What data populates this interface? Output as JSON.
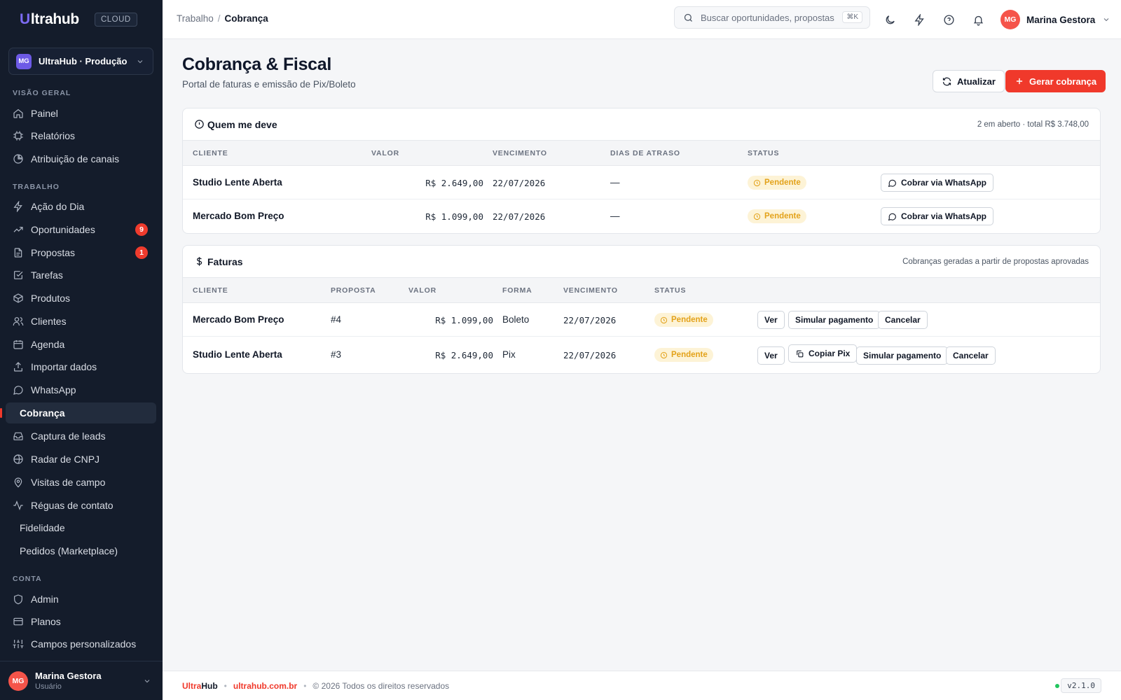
{
  "app": {
    "logo_text": "ltrahub",
    "logo_mark": "U",
    "cloud_badge": "CLOUD",
    "workspace": {
      "initials": "MG",
      "name": "UltraHub · Produção"
    }
  },
  "sidebar": {
    "sections": {
      "overview": "VISÃO GERAL",
      "work": "TRABALHO",
      "account": "CONTA"
    },
    "overview_items": [
      {
        "label": "Painel",
        "icon": "home-icon"
      },
      {
        "label": "Relatórios",
        "icon": "chip-icon"
      },
      {
        "label": "Atribuição de canais",
        "icon": "pie-chart-icon"
      }
    ],
    "work_items": [
      {
        "label": "Ação do Dia",
        "icon": "bolt-icon"
      },
      {
        "label": "Oportunidades",
        "icon": "trending-up-icon",
        "badge": "9"
      },
      {
        "label": "Propostas",
        "icon": "file-icon",
        "badge": "1"
      },
      {
        "label": "Tarefas",
        "icon": "check-square-icon"
      },
      {
        "label": "Produtos",
        "icon": "box-icon"
      },
      {
        "label": "Clientes",
        "icon": "users-icon"
      },
      {
        "label": "Agenda",
        "icon": "calendar-icon"
      },
      {
        "label": "Importar dados",
        "icon": "upload-icon"
      },
      {
        "label": "WhatsApp",
        "icon": "chat-icon"
      },
      {
        "label": "Cobrança",
        "icon": "none",
        "active": true
      },
      {
        "label": "Captura de leads",
        "icon": "inbox-icon"
      },
      {
        "label": "Radar de CNPJ",
        "icon": "radar-icon"
      },
      {
        "label": "Visitas de campo",
        "icon": "map-pin-icon"
      },
      {
        "label": "Réguas de contato",
        "icon": "activity-icon"
      },
      {
        "label": "Fidelidade",
        "icon": "none"
      },
      {
        "label": "Pedidos (Marketplace)",
        "icon": "none"
      }
    ],
    "account_items": [
      {
        "label": "Admin",
        "icon": "shield-icon"
      },
      {
        "label": "Planos",
        "icon": "credit-card-icon"
      },
      {
        "label": "Campos personalizados",
        "icon": "sliders-icon"
      }
    ],
    "user": {
      "initials": "MG",
      "name": "Marina Gestora",
      "role": "Usuário"
    }
  },
  "topbar": {
    "breadcrumb_parent": "Trabalho",
    "breadcrumb_sep": "/",
    "breadcrumb_current": "Cobrança",
    "search_placeholder": "Buscar oportunidades, propostas...",
    "search_shortcut": "⌘K",
    "user": {
      "initials": "MG",
      "name": "Marina Gestora"
    }
  },
  "page": {
    "title": "Cobrança & Fiscal",
    "subtitle": "Portal de faturas e emissão de Pix/Boleto",
    "refresh_label": "Atualizar",
    "create_label": "Gerar cobrança"
  },
  "debtors": {
    "title": "Quem me deve",
    "meta": "2 em aberto · total R$ 3.748,00",
    "columns": [
      "CLIENTE",
      "VALOR",
      "VENCIMENTO",
      "DIAS DE ATRASO",
      "STATUS"
    ],
    "rows": [
      {
        "client": "Studio Lente Aberta",
        "value": "R$ 2.649,00",
        "due": "22/07/2026",
        "late": "—",
        "status": "Pendente",
        "action": "Cobrar via WhatsApp"
      },
      {
        "client": "Mercado Bom Preço",
        "value": "R$ 1.099,00",
        "due": "22/07/2026",
        "late": "—",
        "status": "Pendente",
        "action": "Cobrar via WhatsApp"
      }
    ]
  },
  "invoices": {
    "title": "Faturas",
    "meta": "Cobranças geradas a partir de propostas aprovadas",
    "columns": [
      "CLIENTE",
      "PROPOSTA",
      "VALOR",
      "FORMA",
      "VENCIMENTO",
      "STATUS"
    ],
    "rows": [
      {
        "client": "Mercado Bom Preço",
        "proposal": "#4",
        "value": "R$ 1.099,00",
        "method": "Boleto",
        "due": "22/07/2026",
        "status": "Pendente",
        "view": "Ver",
        "copy_pix": "",
        "simulate": "Simular pagamento",
        "cancel": "Cancelar"
      },
      {
        "client": "Studio Lente Aberta",
        "proposal": "#3",
        "value": "R$ 2.649,00",
        "method": "Pix",
        "due": "22/07/2026",
        "status": "Pendente",
        "view": "Ver",
        "copy_pix": "Copiar Pix",
        "simulate": "Simular pagamento",
        "cancel": "Cancelar"
      }
    ]
  },
  "footer": {
    "brand_red": "Ultra",
    "brand_dark": "Hub",
    "site": "ultrahub.com.br",
    "copyright": "© 2026 Todos os direitos reservados",
    "version": "v2.1.0",
    "sep": "•"
  },
  "colors": {
    "accent": "#f0392b",
    "sidebar_bg": "#141c2b",
    "pending_bg": "#fdf3d6",
    "pending_fg": "#e3a21a"
  }
}
